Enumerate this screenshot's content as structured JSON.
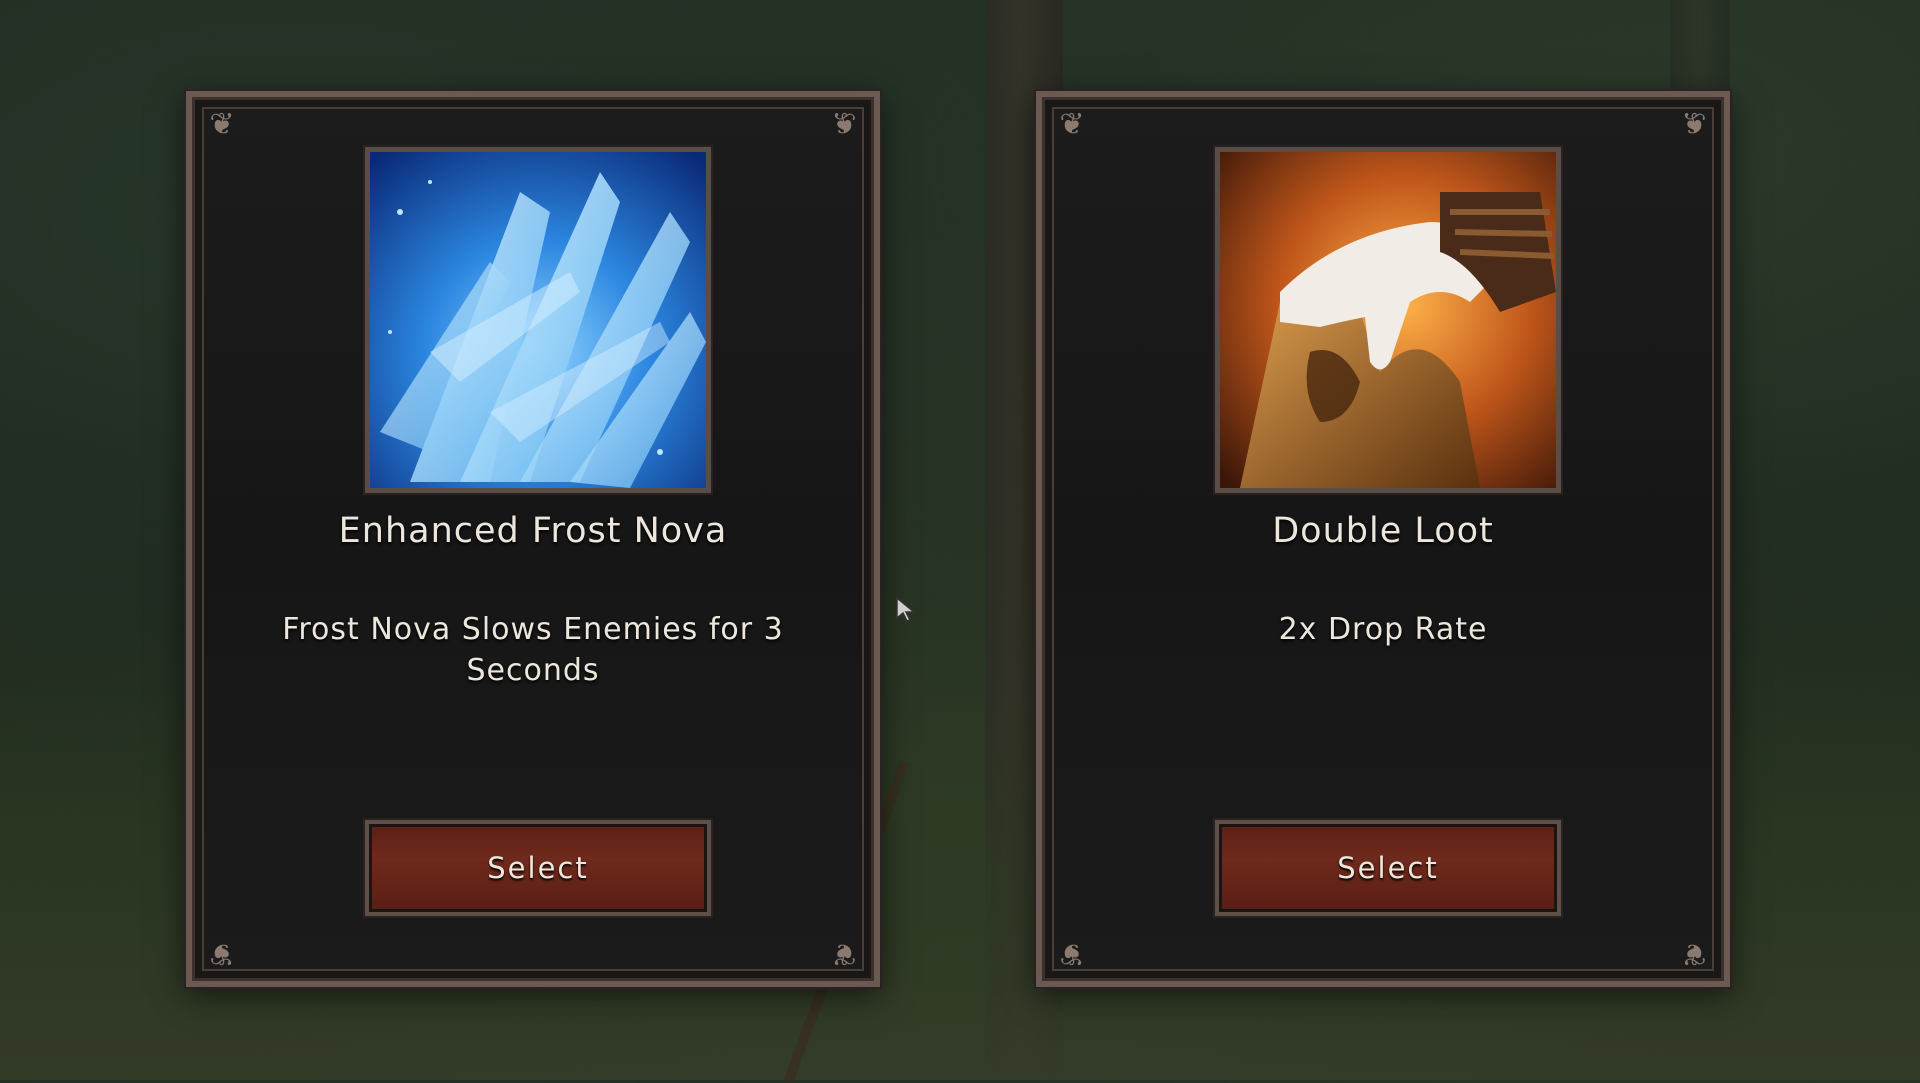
{
  "cards": [
    {
      "title": "Enhanced Frost Nova",
      "description": "Frost Nova Slows Enemies for 3 Seconds",
      "image": "frost-crystal-icon",
      "button_label": "Select",
      "accent": "#3aa0f0"
    },
    {
      "title": "Double Loot",
      "description": "2x Drop Rate",
      "image": "hand-on-treasure-icon",
      "button_label": "Select",
      "accent": "#e08a2a"
    }
  ],
  "colors": {
    "frame": "#6a5a52",
    "panel": "#1a1a1a",
    "button": "#6e2a1c",
    "text": "#ece6dc"
  }
}
